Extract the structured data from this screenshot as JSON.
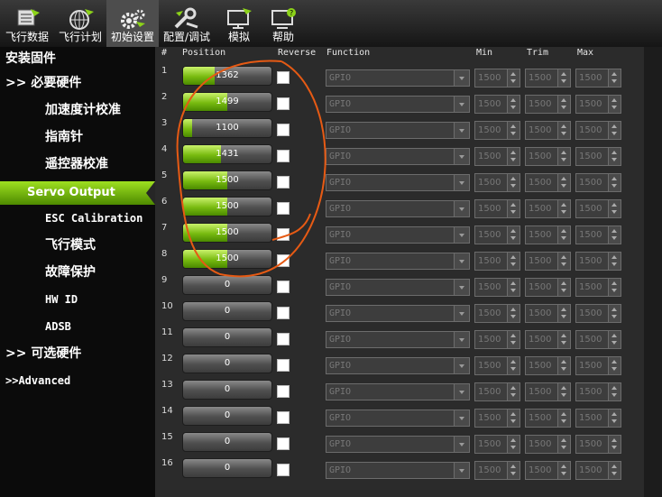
{
  "toolbar": [
    {
      "label": "飞行数据",
      "icon": "flight-data-icon"
    },
    {
      "label": "飞行计划",
      "icon": "flight-plan-icon"
    },
    {
      "label": "初始设置",
      "icon": "initial-setup-icon"
    },
    {
      "label": "配置/调试",
      "icon": "config-tuning-icon"
    },
    {
      "label": "模拟",
      "icon": "simulation-icon"
    },
    {
      "label": "帮助",
      "icon": "help-icon"
    }
  ],
  "sidebar": {
    "items": [
      {
        "label": "安装固件"
      },
      {
        "label": ">> 必要硬件"
      },
      {
        "label": "加速度计校准"
      },
      {
        "label": "指南针"
      },
      {
        "label": "遥控器校准"
      },
      {
        "label": "Servo Output"
      },
      {
        "label": "ESC Calibration"
      },
      {
        "label": "飞行模式"
      },
      {
        "label": "故障保护"
      },
      {
        "label": "HW ID"
      },
      {
        "label": "ADSB"
      },
      {
        "label": ">> 可选硬件"
      },
      {
        "label": ">>Advanced"
      }
    ]
  },
  "table": {
    "headers": {
      "num": "#",
      "position": "Position",
      "reverse": "Reverse",
      "function": "Function",
      "min": "Min",
      "trim": "Trim",
      "max": "Max"
    },
    "rows": [
      {
        "num": "1",
        "position": "1362",
        "position_fraction": 0.36,
        "function": "GPIO",
        "min": "1500",
        "trim": "1500",
        "max": "1500"
      },
      {
        "num": "2",
        "position": "1499",
        "position_fraction": 0.5,
        "function": "GPIO",
        "min": "1500",
        "trim": "1500",
        "max": "1500"
      },
      {
        "num": "3",
        "position": "1100",
        "position_fraction": 0.1,
        "function": "GPIO",
        "min": "1500",
        "trim": "1500",
        "max": "1500"
      },
      {
        "num": "4",
        "position": "1431",
        "position_fraction": 0.43,
        "function": "GPIO",
        "min": "1500",
        "trim": "1500",
        "max": "1500"
      },
      {
        "num": "5",
        "position": "1500",
        "position_fraction": 0.5,
        "function": "GPIO",
        "min": "1500",
        "trim": "1500",
        "max": "1500"
      },
      {
        "num": "6",
        "position": "1500",
        "position_fraction": 0.5,
        "function": "GPIO",
        "min": "1500",
        "trim": "1500",
        "max": "1500"
      },
      {
        "num": "7",
        "position": "1500",
        "position_fraction": 0.5,
        "function": "GPIO",
        "min": "1500",
        "trim": "1500",
        "max": "1500"
      },
      {
        "num": "8",
        "position": "1500",
        "position_fraction": 0.5,
        "function": "GPIO",
        "min": "1500",
        "trim": "1500",
        "max": "1500"
      },
      {
        "num": "9",
        "position": "0",
        "position_fraction": 0,
        "function": "GPIO",
        "min": "1500",
        "trim": "1500",
        "max": "1500"
      },
      {
        "num": "10",
        "position": "0",
        "position_fraction": 0,
        "function": "GPIO",
        "min": "1500",
        "trim": "1500",
        "max": "1500"
      },
      {
        "num": "11",
        "position": "0",
        "position_fraction": 0,
        "function": "GPIO",
        "min": "1500",
        "trim": "1500",
        "max": "1500"
      },
      {
        "num": "12",
        "position": "0",
        "position_fraction": 0,
        "function": "GPIO",
        "min": "1500",
        "trim": "1500",
        "max": "1500"
      },
      {
        "num": "13",
        "position": "0",
        "position_fraction": 0,
        "function": "GPIO",
        "min": "1500",
        "trim": "1500",
        "max": "1500"
      },
      {
        "num": "14",
        "position": "0",
        "position_fraction": 0,
        "function": "GPIO",
        "min": "1500",
        "trim": "1500",
        "max": "1500"
      },
      {
        "num": "15",
        "position": "0",
        "position_fraction": 0,
        "function": "GPIO",
        "min": "1500",
        "trim": "1500",
        "max": "1500"
      },
      {
        "num": "16",
        "position": "0",
        "position_fraction": 0,
        "function": "GPIO",
        "min": "1500",
        "trim": "1500",
        "max": "1500"
      }
    ]
  },
  "colors": {
    "accent_green": "#8cd219",
    "annotation": "#e65a14",
    "background": "#2b2b2b"
  }
}
